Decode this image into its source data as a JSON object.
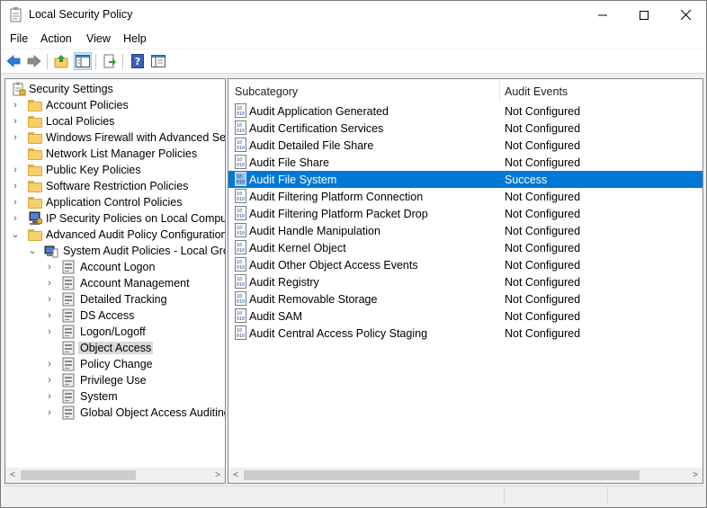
{
  "window": {
    "title": "Local Security Policy",
    "controls": {
      "minimize": "minimize",
      "maximize": "maximize",
      "close": "close"
    }
  },
  "menu": {
    "file": "File",
    "action": "Action",
    "view": "View",
    "help": "Help"
  },
  "toolbar": {
    "icons": [
      "back-arrow-icon",
      "forward-arrow-icon",
      "up-folder-icon",
      "show-hide-tree-icon",
      "export-list-icon",
      "help-icon",
      "properties-icon"
    ]
  },
  "tree": {
    "root": "Security Settings",
    "items": [
      {
        "label": "Account Policies",
        "icon": "folder-lock"
      },
      {
        "label": "Local Policies",
        "icon": "folder-lock"
      },
      {
        "label": "Windows Firewall with Advanced Security",
        "icon": "folder"
      },
      {
        "label": "Network List Manager Policies",
        "icon": "folder"
      },
      {
        "label": "Public Key Policies",
        "icon": "folder"
      },
      {
        "label": "Software Restriction Policies",
        "icon": "folder"
      },
      {
        "label": "Application Control Policies",
        "icon": "folder"
      },
      {
        "label": "IP Security Policies on Local Computer",
        "icon": "ipsec"
      },
      {
        "label": "Advanced Audit Policy Configuration",
        "icon": "folder",
        "expanded": true
      }
    ],
    "system_audit": "System Audit Policies - Local Group Policy Object",
    "audit_children": [
      "Account Logon",
      "Account Management",
      "Detailed Tracking",
      "DS Access",
      "Logon/Logoff",
      "Object Access",
      "Policy Change",
      "Privilege Use",
      "System",
      "Global Object Access Auditing"
    ],
    "selected": "Object Access"
  },
  "list": {
    "columns": {
      "subcategory": "Subcategory",
      "audit_events": "Audit Events"
    },
    "rows": [
      {
        "subcategory": "Audit Application Generated",
        "audit_events": "Not Configured"
      },
      {
        "subcategory": "Audit Certification Services",
        "audit_events": "Not Configured"
      },
      {
        "subcategory": "Audit Detailed File Share",
        "audit_events": "Not Configured"
      },
      {
        "subcategory": "Audit File Share",
        "audit_events": "Not Configured"
      },
      {
        "subcategory": "Audit File System",
        "audit_events": "Success",
        "selected": true
      },
      {
        "subcategory": "Audit Filtering Platform Connection",
        "audit_events": "Not Configured"
      },
      {
        "subcategory": "Audit Filtering Platform Packet Drop",
        "audit_events": "Not Configured"
      },
      {
        "subcategory": "Audit Handle Manipulation",
        "audit_events": "Not Configured"
      },
      {
        "subcategory": "Audit Kernel Object",
        "audit_events": "Not Configured"
      },
      {
        "subcategory": "Audit Other Object Access Events",
        "audit_events": "Not Configured"
      },
      {
        "subcategory": "Audit Registry",
        "audit_events": "Not Configured"
      },
      {
        "subcategory": "Audit Removable Storage",
        "audit_events": "Not Configured"
      },
      {
        "subcategory": "Audit SAM",
        "audit_events": "Not Configured"
      },
      {
        "subcategory": "Audit Central Access Policy Staging",
        "audit_events": "Not Configured"
      }
    ]
  },
  "colors": {
    "selection": "#0078d7",
    "tree_selection": "#d9d9d9",
    "toolbar_arrow": "#2d7bd6"
  }
}
